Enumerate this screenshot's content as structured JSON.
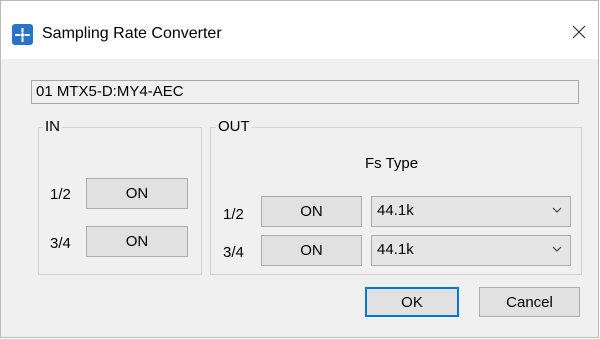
{
  "window": {
    "title": "Sampling Rate Converter"
  },
  "device": {
    "name": "01 MTX5-D:MY4-AEC"
  },
  "in_group": {
    "label": "IN",
    "rows": [
      {
        "channel": "1/2",
        "button": "ON"
      },
      {
        "channel": "3/4",
        "button": "ON"
      }
    ]
  },
  "out_group": {
    "label": "OUT",
    "fs_type_label": "Fs Type",
    "rows": [
      {
        "channel": "1/2",
        "button": "ON",
        "fs_type": "44.1k"
      },
      {
        "channel": "3/4",
        "button": "ON",
        "fs_type": "44.1k"
      }
    ]
  },
  "footer": {
    "ok_label": "OK",
    "cancel_label": "Cancel"
  },
  "icons": {
    "app": "sampling-rate-converter-icon",
    "close": "close-icon",
    "dropdown": "chevron-down-icon"
  },
  "colors": {
    "accent": "#0078d7",
    "app_icon": "#2a73c9"
  }
}
